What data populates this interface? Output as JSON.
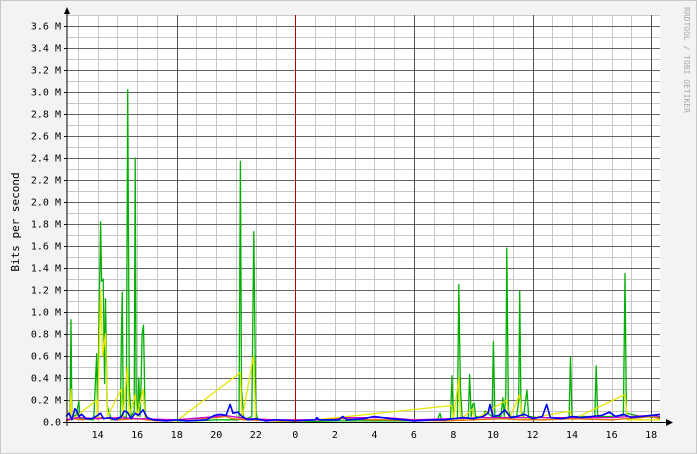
{
  "chart_data": {
    "type": "line",
    "title": "",
    "ylabel": "Bits per second",
    "watermark": "RRDTOOL / TOBI OETIKER",
    "ylim": [
      0,
      3.7
    ],
    "y_unit_label": "M",
    "y_ticks": [
      "0.0",
      "0.2 M",
      "0.4 M",
      "0.6 M",
      "0.8 M",
      "1.0 M",
      "1.2 M",
      "1.4 M",
      "1.6 M",
      "1.8 M",
      "2.0 M",
      "2.2 M",
      "2.4 M",
      "2.6 M",
      "2.8 M",
      "3.0 M",
      "3.2 M",
      "3.4 M",
      "3.6 M"
    ],
    "x_ticks": [
      "14",
      "16",
      "18",
      "20",
      "22",
      "0",
      "2",
      "4",
      "6",
      "8",
      "10",
      "12",
      "14",
      "16",
      "18"
    ],
    "x_tick_hours": [
      -10,
      -8,
      -6,
      -4,
      -2,
      0,
      2,
      4,
      6,
      8,
      10,
      12,
      14,
      16,
      18
    ],
    "xlim_hours": [
      -11.55,
      18.45
    ],
    "major_grid_hours": [
      -6,
      0,
      6,
      12,
      18
    ],
    "now_marker_hour": 0,
    "grid": true,
    "colors": {
      "background": "#f3f3f3",
      "canvas": "#ffffff",
      "major_grid": "#000000",
      "minor_grid": "#c8c8c8",
      "now_line": "#b00000",
      "axis_arrow": "#000000"
    },
    "series": [
      {
        "color": "#00b000",
        "style": "line",
        "points": [
          [
            -11.6,
            0.01
          ],
          [
            -11.4,
            0.02
          ],
          [
            -11.35,
            0.93
          ],
          [
            -11.3,
            0.05
          ],
          [
            -11.1,
            0.06
          ],
          [
            -10.95,
            0.19
          ],
          [
            -10.9,
            0.03
          ],
          [
            -10.2,
            0.02
          ],
          [
            -10.05,
            0.62
          ],
          [
            -10.0,
            0.05
          ],
          [
            -9.85,
            1.82
          ],
          [
            -9.8,
            1.28
          ],
          [
            -9.72,
            1.3
          ],
          [
            -9.65,
            0.35
          ],
          [
            -9.6,
            1.12
          ],
          [
            -9.52,
            0.15
          ],
          [
            -9.3,
            0.02
          ],
          [
            -8.85,
            0.03
          ],
          [
            -8.8,
            0.8
          ],
          [
            -8.75,
            1.18
          ],
          [
            -8.7,
            0.05
          ],
          [
            -8.55,
            0.04
          ],
          [
            -8.48,
            3.02
          ],
          [
            -8.4,
            0.3
          ],
          [
            -8.3,
            0.05
          ],
          [
            -8.15,
            0.1
          ],
          [
            -8.1,
            2.4
          ],
          [
            -8.05,
            0.2
          ],
          [
            -7.98,
            0.05
          ],
          [
            -7.92,
            0.4
          ],
          [
            -7.85,
            0.05
          ],
          [
            -7.8,
            0.35
          ],
          [
            -7.75,
            0.8
          ],
          [
            -7.68,
            0.88
          ],
          [
            -7.6,
            0.05
          ],
          [
            -7.3,
            0.02
          ],
          [
            -6.5,
            0.01
          ],
          [
            -5.0,
            0.01
          ],
          [
            -4.0,
            0.02
          ],
          [
            -3.5,
            0.02
          ],
          [
            -2.85,
            0.02
          ],
          [
            -2.78,
            2.37
          ],
          [
            -2.72,
            0.3
          ],
          [
            -2.6,
            0.02
          ],
          [
            -2.2,
            0.05
          ],
          [
            -2.1,
            1.73
          ],
          [
            -2.0,
            0.1
          ],
          [
            -1.9,
            0.02
          ],
          [
            -1.0,
            0.01
          ],
          [
            0.0,
            0.0
          ],
          [
            2.0,
            0.01
          ],
          [
            4.0,
            0.01
          ],
          [
            6.0,
            0.01
          ],
          [
            7.2,
            0.02
          ],
          [
            7.32,
            0.08
          ],
          [
            7.4,
            0.02
          ],
          [
            7.85,
            0.02
          ],
          [
            7.92,
            0.42
          ],
          [
            8.0,
            0.03
          ],
          [
            8.2,
            0.03
          ],
          [
            8.27,
            1.25
          ],
          [
            8.35,
            0.3
          ],
          [
            8.45,
            0.03
          ],
          [
            8.75,
            0.04
          ],
          [
            8.82,
            0.43
          ],
          [
            8.9,
            0.05
          ],
          [
            8.97,
            0.16
          ],
          [
            9.05,
            0.17
          ],
          [
            9.12,
            0.05
          ],
          [
            9.5,
            0.04
          ],
          [
            9.6,
            0.1
          ],
          [
            9.95,
            0.05
          ],
          [
            10.02,
            0.73
          ],
          [
            10.1,
            0.05
          ],
          [
            10.4,
            0.05
          ],
          [
            10.5,
            0.22
          ],
          [
            10.57,
            0.05
          ],
          [
            10.65,
            0.25
          ],
          [
            10.7,
            1.58
          ],
          [
            10.78,
            0.1
          ],
          [
            10.9,
            0.05
          ],
          [
            11.2,
            0.05
          ],
          [
            11.3,
            0.2
          ],
          [
            11.35,
            1.19
          ],
          [
            11.42,
            0.1
          ],
          [
            11.55,
            0.05
          ],
          [
            11.65,
            0.2
          ],
          [
            11.72,
            0.29
          ],
          [
            11.8,
            0.05
          ],
          [
            12.5,
            0.04
          ],
          [
            13.85,
            0.04
          ],
          [
            13.92,
            0.59
          ],
          [
            14.0,
            0.05
          ],
          [
            15.15,
            0.05
          ],
          [
            15.22,
            0.51
          ],
          [
            15.3,
            0.05
          ],
          [
            15.9,
            0.05
          ],
          [
            16.6,
            0.06
          ],
          [
            16.68,
            1.35
          ],
          [
            16.75,
            0.08
          ],
          [
            17.5,
            0.05
          ],
          [
            18.45,
            0.04
          ]
        ]
      },
      {
        "color": "#e6e600",
        "style": "line",
        "points": [
          [
            -11.6,
            0.01
          ],
          [
            -11.4,
            0.02
          ],
          [
            -11.35,
            0.3
          ],
          [
            -11.3,
            0.02
          ],
          [
            -10.05,
            0.2
          ],
          [
            -10.0,
            0.02
          ],
          [
            -9.85,
            1.2
          ],
          [
            -9.75,
            0.6
          ],
          [
            -9.6,
            0.8
          ],
          [
            -9.5,
            0.05
          ],
          [
            -8.8,
            0.3
          ],
          [
            -8.72,
            0.05
          ],
          [
            -8.5,
            0.5
          ],
          [
            -8.4,
            0.05
          ],
          [
            -8.1,
            0.25
          ],
          [
            -8.0,
            0.05
          ],
          [
            -7.7,
            0.3
          ],
          [
            -7.6,
            0.02
          ],
          [
            -6.0,
            0.01
          ],
          [
            -2.78,
            0.45
          ],
          [
            -2.7,
            0.02
          ],
          [
            -2.12,
            0.6
          ],
          [
            -2.0,
            0.02
          ],
          [
            0.0,
            0.0
          ],
          [
            7.92,
            0.15
          ],
          [
            8.0,
            0.02
          ],
          [
            8.27,
            0.4
          ],
          [
            8.35,
            0.02
          ],
          [
            8.97,
            0.12
          ],
          [
            9.05,
            0.02
          ],
          [
            10.7,
            0.2
          ],
          [
            10.8,
            0.02
          ],
          [
            11.35,
            0.25
          ],
          [
            11.45,
            0.02
          ],
          [
            13.92,
            0.1
          ],
          [
            14.0,
            0.02
          ],
          [
            16.68,
            0.25
          ],
          [
            16.8,
            0.02
          ],
          [
            18.45,
            0.02
          ]
        ]
      },
      {
        "color": "#e07000",
        "style": "line",
        "points": [
          [
            -11.6,
            0.01
          ],
          [
            -11.2,
            0.03
          ],
          [
            -10.8,
            0.02
          ],
          [
            -9.8,
            0.04
          ],
          [
            -9.0,
            0.02
          ],
          [
            -8.0,
            0.03
          ],
          [
            -7.0,
            0.01
          ],
          [
            -4.0,
            0.04
          ],
          [
            -3.5,
            0.05
          ],
          [
            -3.2,
            0.03
          ],
          [
            -2.5,
            0.02
          ],
          [
            -1.0,
            0.01
          ],
          [
            0.0,
            0.01
          ],
          [
            2.4,
            0.03
          ],
          [
            3.8,
            0.02
          ],
          [
            4.5,
            0.02
          ],
          [
            7.5,
            0.01
          ],
          [
            9.0,
            0.02
          ],
          [
            10.5,
            0.03
          ],
          [
            11.5,
            0.02
          ],
          [
            12.5,
            0.02
          ],
          [
            14.0,
            0.03
          ],
          [
            16.0,
            0.02
          ],
          [
            17.5,
            0.04
          ],
          [
            18.0,
            0.05
          ],
          [
            18.45,
            0.03
          ]
        ]
      },
      {
        "color": "#cc00cc",
        "style": "line",
        "points": [
          [
            -11.6,
            0.02
          ],
          [
            -11.0,
            0.04
          ],
          [
            -10.0,
            0.03
          ],
          [
            -9.0,
            0.04
          ],
          [
            -8.0,
            0.03
          ],
          [
            -6.0,
            0.02
          ],
          [
            -4.0,
            0.05
          ],
          [
            -3.6,
            0.06
          ],
          [
            -3.2,
            0.05
          ],
          [
            -2.4,
            0.03
          ],
          [
            -1.0,
            0.02
          ],
          [
            0.0,
            0.02
          ],
          [
            2.0,
            0.02
          ],
          [
            2.4,
            0.04
          ],
          [
            3.6,
            0.04
          ],
          [
            4.6,
            0.04
          ],
          [
            6.0,
            0.02
          ],
          [
            8.0,
            0.03
          ],
          [
            9.5,
            0.04
          ],
          [
            11.0,
            0.04
          ],
          [
            12.5,
            0.04
          ],
          [
            14.0,
            0.04
          ],
          [
            16.0,
            0.04
          ],
          [
            17.0,
            0.05
          ],
          [
            18.0,
            0.06
          ],
          [
            18.45,
            0.05
          ]
        ]
      },
      {
        "color": "#0000ff",
        "style": "line",
        "points": [
          [
            -11.6,
            0.05
          ],
          [
            -11.45,
            0.08
          ],
          [
            -11.3,
            0.02
          ],
          [
            -11.15,
            0.12
          ],
          [
            -11.05,
            0.1
          ],
          [
            -10.95,
            0.05
          ],
          [
            -10.8,
            0.07
          ],
          [
            -10.6,
            0.03
          ],
          [
            -10.3,
            0.03
          ],
          [
            -10.0,
            0.06
          ],
          [
            -9.85,
            0.08
          ],
          [
            -9.7,
            0.03
          ],
          [
            -9.4,
            0.04
          ],
          [
            -9.1,
            0.02
          ],
          [
            -8.8,
            0.05
          ],
          [
            -8.65,
            0.1
          ],
          [
            -8.5,
            0.09
          ],
          [
            -8.3,
            0.03
          ],
          [
            -8.1,
            0.08
          ],
          [
            -7.95,
            0.06
          ],
          [
            -7.7,
            0.11
          ],
          [
            -7.5,
            0.04
          ],
          [
            -7.2,
            0.02
          ],
          [
            -6.5,
            0.01
          ],
          [
            -6.0,
            0.02
          ],
          [
            -5.5,
            0.01
          ],
          [
            -4.5,
            0.02
          ],
          [
            -4.1,
            0.06
          ],
          [
            -3.8,
            0.07
          ],
          [
            -3.5,
            0.06
          ],
          [
            -3.3,
            0.16
          ],
          [
            -3.15,
            0.08
          ],
          [
            -2.9,
            0.09
          ],
          [
            -2.7,
            0.05
          ],
          [
            -2.4,
            0.02
          ],
          [
            -2.0,
            0.03
          ],
          [
            -1.5,
            0.01
          ],
          [
            -1.0,
            0.02
          ],
          [
            0.0,
            0.01
          ],
          [
            1.0,
            0.02
          ],
          [
            1.1,
            0.04
          ],
          [
            1.2,
            0.02
          ],
          [
            2.2,
            0.02
          ],
          [
            2.4,
            0.05
          ],
          [
            2.6,
            0.02
          ],
          [
            3.5,
            0.03
          ],
          [
            3.7,
            0.04
          ],
          [
            4.0,
            0.05
          ],
          [
            4.4,
            0.04
          ],
          [
            4.8,
            0.03
          ],
          [
            5.5,
            0.02
          ],
          [
            6.0,
            0.01
          ],
          [
            7.0,
            0.02
          ],
          [
            7.5,
            0.02
          ],
          [
            8.0,
            0.03
          ],
          [
            8.5,
            0.04
          ],
          [
            9.0,
            0.03
          ],
          [
            9.5,
            0.05
          ],
          [
            9.75,
            0.08
          ],
          [
            9.85,
            0.16
          ],
          [
            10.0,
            0.05
          ],
          [
            10.3,
            0.06
          ],
          [
            10.6,
            0.11
          ],
          [
            10.9,
            0.04
          ],
          [
            11.2,
            0.05
          ],
          [
            11.6,
            0.07
          ],
          [
            12.0,
            0.03
          ],
          [
            12.5,
            0.05
          ],
          [
            12.72,
            0.16
          ],
          [
            12.9,
            0.04
          ],
          [
            13.5,
            0.03
          ],
          [
            14.0,
            0.05
          ],
          [
            14.5,
            0.04
          ],
          [
            15.0,
            0.05
          ],
          [
            15.5,
            0.06
          ],
          [
            15.9,
            0.09
          ],
          [
            16.2,
            0.05
          ],
          [
            16.6,
            0.07
          ],
          [
            17.0,
            0.04
          ],
          [
            17.5,
            0.05
          ],
          [
            18.0,
            0.06
          ],
          [
            18.45,
            0.07
          ]
        ]
      }
    ]
  }
}
